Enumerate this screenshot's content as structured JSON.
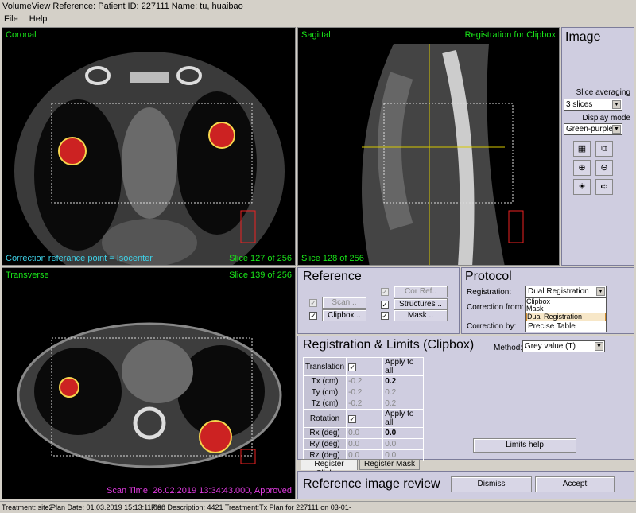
{
  "window": {
    "title": "VolumeView Reference: Patient ID: 227111  Name: tu, huaibao"
  },
  "menu": [
    "File",
    "Help"
  ],
  "coronal": {
    "label": "Coronal",
    "correction_text": "Correction referance point = Isocenter",
    "slice": "Slice 127 of 256"
  },
  "sagittal": {
    "label": "Sagittal",
    "registration_text": "Registration for Clipbox",
    "slice": "Slice 128 of 256"
  },
  "transverse": {
    "label": "Transverse",
    "slice": "Slice 139 of 256",
    "scan_time": "Scan Time: 26.02.2019 13:34:43.000,  Approved"
  },
  "image_panel": {
    "title": "Image",
    "slice_averaging_label": "Slice averaging",
    "slice_averaging_value": "3 slices",
    "display_mode_label": "Display mode",
    "display_mode_value": "Green-purple"
  },
  "reference": {
    "title": "Reference",
    "scan": "Scan ..",
    "clipbox": "Clipbox ..",
    "cor_ref": "Cor Ref..",
    "structures": "Structures ..",
    "mask": "Mask .."
  },
  "protocol": {
    "title": "Protocol",
    "registration_label": "Registration:",
    "registration_value": "Dual Registration",
    "options": [
      "Clipbox",
      "Mask",
      "Dual Registration"
    ],
    "correction_from_label": "Correction from:",
    "correction_by_label": "Correction by:",
    "correction_by_value": "Precise Table"
  },
  "registration": {
    "title": "Registration & Limits (Clipbox)",
    "method_label": "Method:",
    "method_value": "Grey value (T)",
    "rows": [
      {
        "name": "Translation",
        "c1": "",
        "c2": "Apply to all"
      },
      {
        "name": "Tx (cm)",
        "c1": "-0.2",
        "c2": "0.2"
      },
      {
        "name": "Ty (cm)",
        "c1": "-0.2",
        "c2": "0.2"
      },
      {
        "name": "Tz (cm)",
        "c1": "-0.2",
        "c2": "0.2"
      },
      {
        "name": "Rotation",
        "c1": "",
        "c2": "Apply to all"
      },
      {
        "name": "Rx (deg)",
        "c1": "0.0",
        "c2": "0.0"
      },
      {
        "name": "Ry (deg)",
        "c1": "0.0",
        "c2": "0.0"
      },
      {
        "name": "Rz (deg)",
        "c1": "0.0",
        "c2": "0.0"
      }
    ],
    "limits_help": "Limits help"
  },
  "tabs": [
    "Register Clipbox",
    "Register Mask"
  ],
  "review": {
    "title": "Reference image review",
    "dismiss": "Dismiss",
    "accept": "Accept"
  },
  "status": {
    "treatment": "Treatment: site2",
    "plan_date": "Plan Date: 01.03.2019 15:13:11.000",
    "plan_desc": "Plan Description: 4421 Treatment:Tx Plan for 227111 on 03-01-"
  },
  "colors": {
    "overlay_green": "#19e619",
    "overlay_cyan": "#3fd2e8",
    "overlay_magenta": "#e23be2"
  }
}
